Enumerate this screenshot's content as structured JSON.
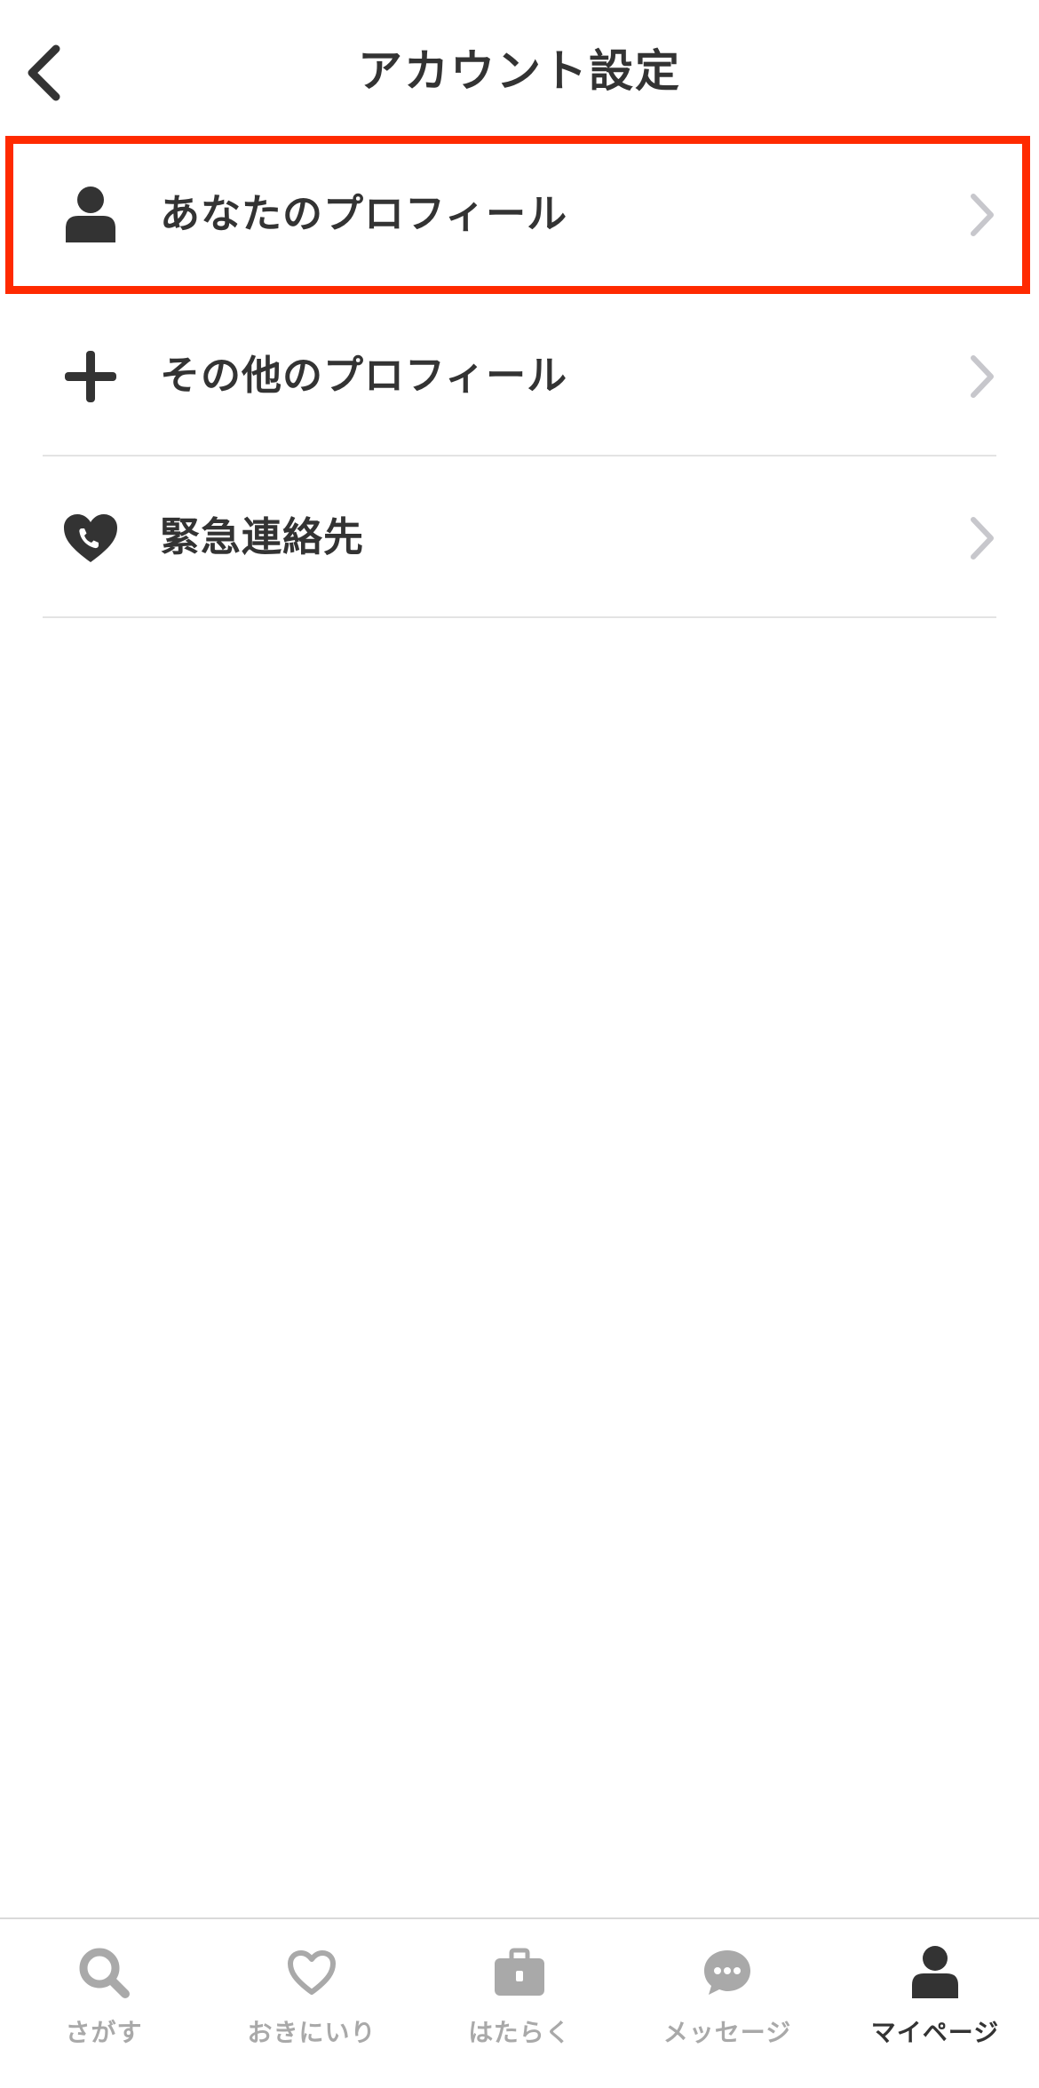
{
  "header": {
    "title": "アカウント設定",
    "back_icon": "chevron-left-icon"
  },
  "menu": {
    "items": [
      {
        "label": "あなたのプロフィール",
        "icon": "person-icon",
        "highlighted": true
      },
      {
        "label": "その他のプロフィール",
        "icon": "plus-icon"
      },
      {
        "label": "緊急連絡先",
        "icon": "heart-phone-icon"
      }
    ]
  },
  "tabbar": {
    "items": [
      {
        "label": "さがす",
        "icon": "search-icon",
        "active": false
      },
      {
        "label": "おきにいり",
        "icon": "heart-icon",
        "active": false
      },
      {
        "label": "はたらく",
        "icon": "briefcase-icon",
        "active": false
      },
      {
        "label": "メッセージ",
        "icon": "chat-bubble-icon",
        "active": false
      },
      {
        "label": "マイページ",
        "icon": "person-icon",
        "active": true
      }
    ]
  },
  "colors": {
    "text": "#333333",
    "highlight": "#ff2a00",
    "inactive": "#a9a9a9",
    "divider": "#e3e3e3",
    "chevron": "#c7c7cc"
  }
}
